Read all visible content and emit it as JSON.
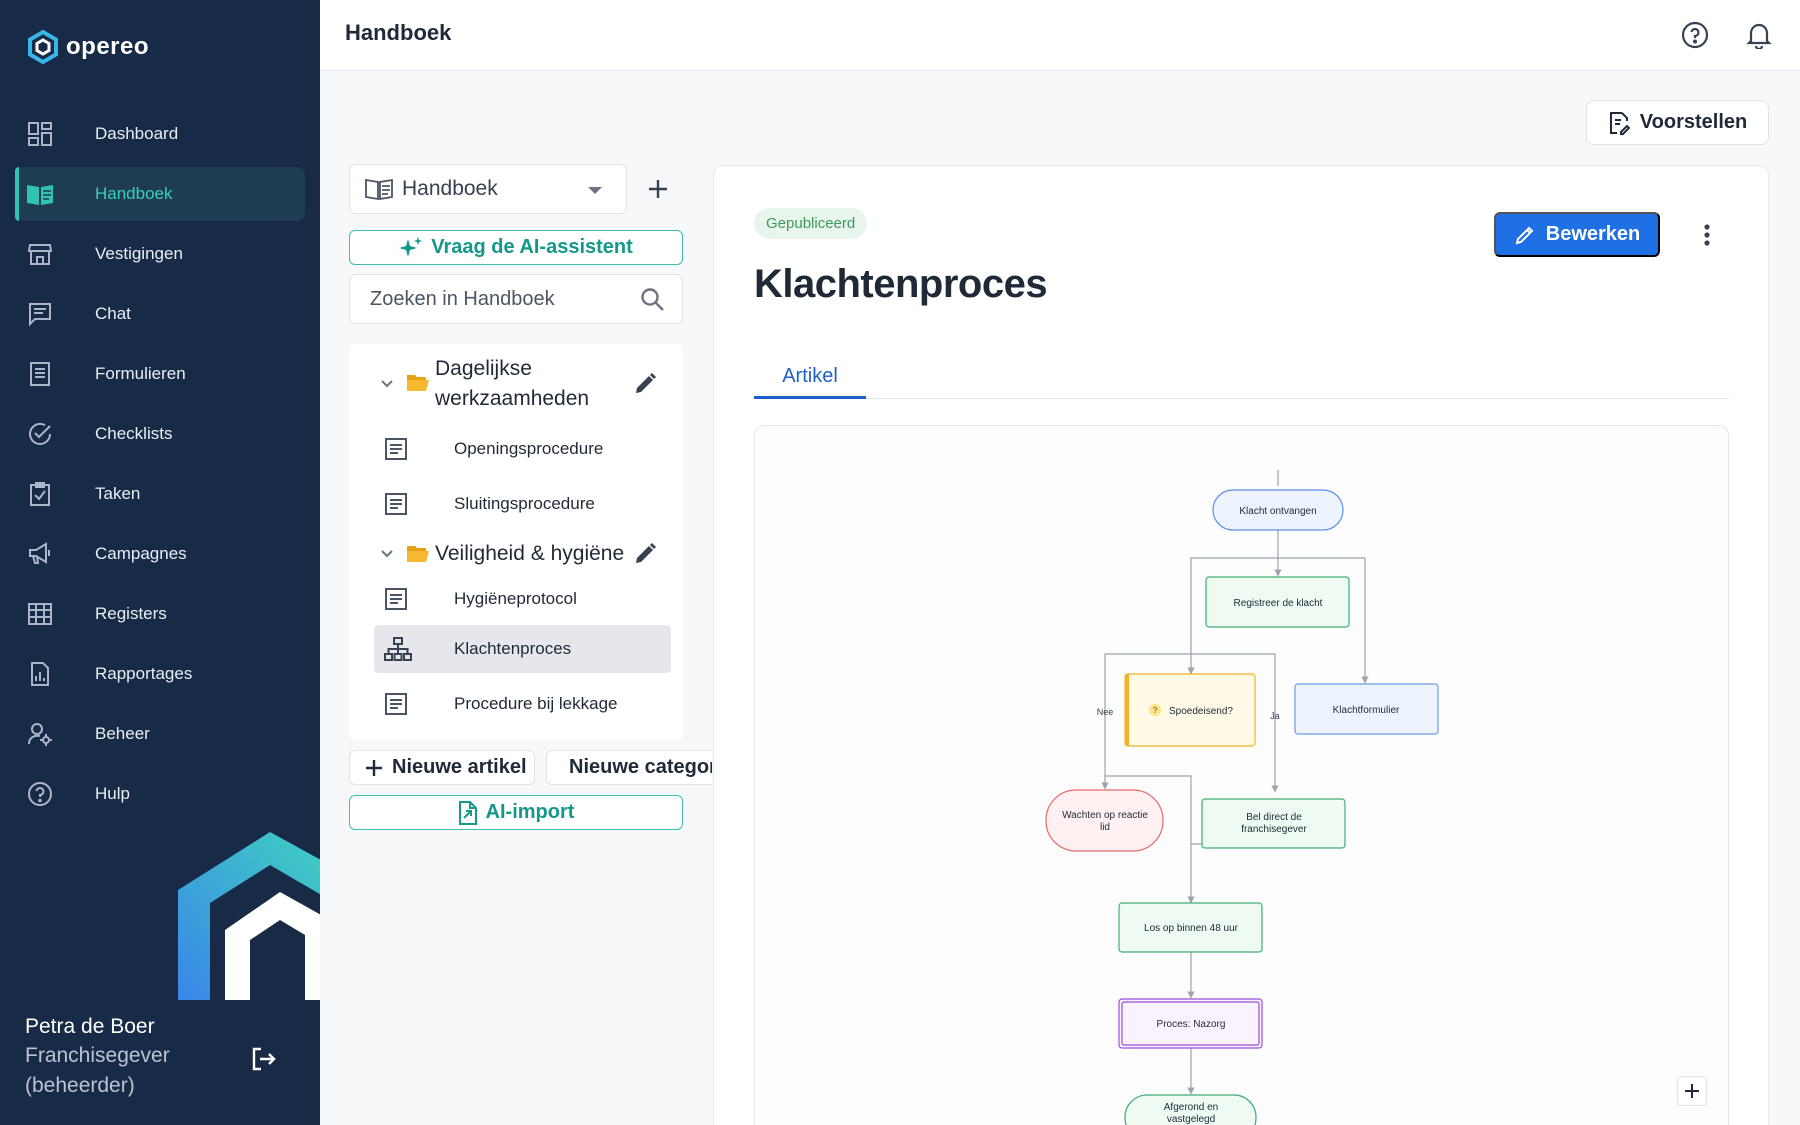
{
  "app": {
    "logo_text": "opereo"
  },
  "sidebar": {
    "items": [
      {
        "label": "Dashboard",
        "icon": "dashboard-icon"
      },
      {
        "label": "Handboek",
        "icon": "book-icon",
        "active": true
      },
      {
        "label": "Vestigingen",
        "icon": "store-icon"
      },
      {
        "label": "Chat",
        "icon": "chat-icon"
      },
      {
        "label": "Formulieren",
        "icon": "form-icon"
      },
      {
        "label": "Checklists",
        "icon": "check-circle-icon"
      },
      {
        "label": "Taken",
        "icon": "clipboard-check-icon"
      },
      {
        "label": "Campagnes",
        "icon": "megaphone-icon"
      },
      {
        "label": "Registers",
        "icon": "grid-icon"
      },
      {
        "label": "Rapportages",
        "icon": "report-icon"
      },
      {
        "label": "Beheer",
        "icon": "user-gear-icon"
      },
      {
        "label": "Hulp",
        "icon": "help-icon"
      }
    ],
    "user": {
      "name": "Petra de Boer",
      "role": "Franchisegever (beheerder)"
    }
  },
  "header": {
    "title": "Handboek"
  },
  "toolbar": {
    "propose_label": "Voorstellen"
  },
  "tree_panel": {
    "handbook_select": "Handboek",
    "ai_assistant_label": "Vraag de AI-assistent",
    "search_placeholder": "Zoeken in Handboek",
    "folders": [
      {
        "label": "Dagelijkse werkzaamheden",
        "items": [
          "Openingsprocedure",
          "Sluitingsprocedure"
        ]
      },
      {
        "label": "Veiligheid & hygiëne",
        "items": [
          "Hygiëneprotocol",
          "Klachtenproces",
          "Procedure bij lekkage"
        ]
      }
    ],
    "active_item": "Klachtenproces",
    "new_article_label": "Nieuwe artikel",
    "new_category_label": "Nieuwe categorie",
    "ai_import_label": "AI-import"
  },
  "article": {
    "status": "Gepubliceerd",
    "title": "Klachtenproces",
    "edit_label": "Bewerken",
    "tabs": [
      "Artikel"
    ]
  },
  "flowchart": {
    "nodes": {
      "start": "Klacht ontvangen",
      "register": "Registreer de klacht",
      "decision": "Spoedeisend?",
      "decision_badge": "?",
      "form": "Klachtformulier",
      "wait": [
        "Wachten op reactie",
        "lid"
      ],
      "call": [
        "Bel direct de",
        "franchisegever"
      ],
      "resolve": "Los op binnen 48 uur",
      "subprocess": "Proces: Nazorg",
      "end": [
        "Afgerond en",
        "vastgelegd"
      ]
    },
    "edge_labels": {
      "no": "Nee",
      "yes": "Ja"
    },
    "colors": {
      "start": "#5b8def",
      "register": "#3fae73",
      "decision": "#f0b429",
      "form": "#6b9be0",
      "wait": "#e86a6a",
      "subprocess": "#9b4fd6"
    }
  }
}
